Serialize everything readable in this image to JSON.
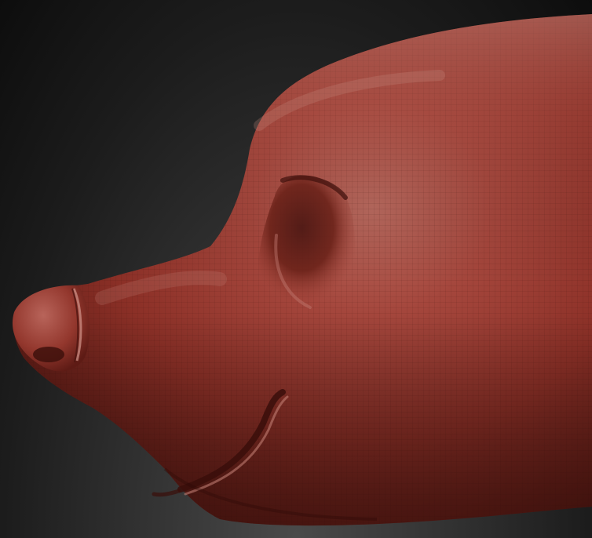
{
  "scene": {
    "subject": "sculpted-animal-head",
    "material_color": "#a4463c",
    "highlight_color": "#c97a6c",
    "shadow_color": "#4a1612",
    "background_top": "#111111",
    "background_bottom": "#4a4a4a"
  }
}
